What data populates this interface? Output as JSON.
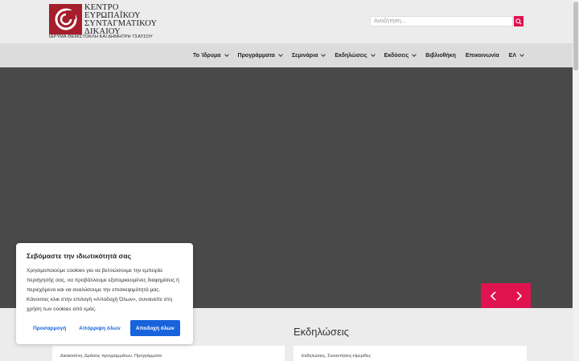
{
  "header": {
    "logo_lines": [
      "ΚΕΝΤΡΟ",
      "ΕΥΡΩΠΑΪΚΟΥ",
      "ΣΥΝΤΑΓΜΑΤΙΚΟΥ",
      "ΔΙΚΑΙΟΥ"
    ],
    "logo_subtitle": "ΙΔΡΥΜΑ ΘΕΜΙΣΤΟΚΛΗ ΚΑΙ ΔΗΜΗΤΡΗ ΤΣΑΤΣΟΥ",
    "search_placeholder": "Αναζήτηση..."
  },
  "nav": {
    "items": [
      {
        "label": "Το Ίδρυμα",
        "dropdown": true
      },
      {
        "label": "Προγράμματα",
        "dropdown": true
      },
      {
        "label": "Σεμινάρια",
        "dropdown": true
      },
      {
        "label": "Εκδηλώσεις",
        "dropdown": true
      },
      {
        "label": "Εκδόσεις",
        "dropdown": true
      },
      {
        "label": "Βιβλιοθήκη",
        "dropdown": false
      },
      {
        "label": "Επικοινωνία",
        "dropdown": false
      },
      {
        "label": "ΕΛ",
        "dropdown": true
      }
    ]
  },
  "main": {
    "events_title": "Εκδηλώσεις",
    "card_left_tags": "Δικαιοσύνη, Δράσεις προγραμμάτων, Προγράμματα",
    "card_right_tags": "Εκδηλώσεις, Συναντήσεις-Ημερίδες"
  },
  "cookie": {
    "title": "Σεβόμαστε την ιδιωτικότητά σας",
    "body": "Χρησιμοποιούμε cookies για να βελτιώσουμε την εμπειρία περιήγησής σας, να προβάλλουμε εξατομικευμένες διαφημίσεις ή περιεχόμενο και να αναλύσουμε την επισκεψιμότητά μας. Κάνοντας κλικ στην επιλογή «Αποδοχή Όλων», συναινείτε στη χρήση των cookies από εμάς.",
    "customize_label": "Προσαρμογή",
    "reject_label": "Απόρριψη όλων",
    "accept_label": "Αποδοχή όλων"
  },
  "colors": {
    "accent": "#e0134f",
    "logo_red": "#a51e2b",
    "cookie_blue": "#1863dc",
    "hero_bg": "#494949"
  }
}
